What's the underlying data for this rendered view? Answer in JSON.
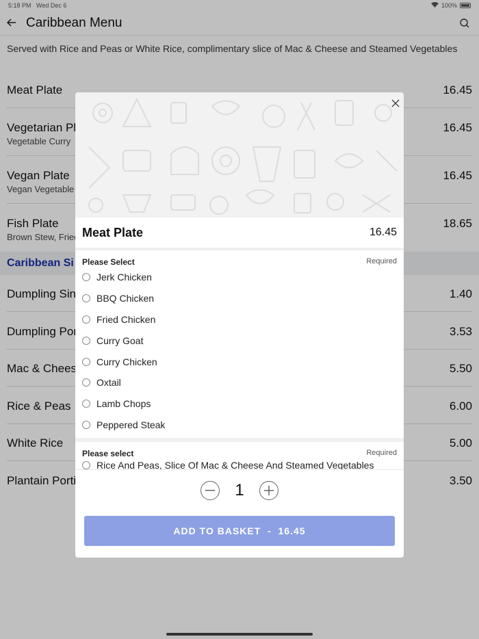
{
  "status": {
    "time": "5:18 PM",
    "date": "Wed Dec 6",
    "battery": "100%"
  },
  "nav": {
    "title": "Caribbean Menu",
    "back_icon": "arrow-left-icon",
    "search_icon": "search-icon"
  },
  "description": "Served with Rice and Peas or White Rice, complimentary slice of Mac & Cheese and Steamed Vegetables",
  "menu": [
    {
      "name": "Meat Plate",
      "sub": "",
      "price": "16.45"
    },
    {
      "name": "Vegetarian Pl",
      "sub": "Vegetable Curry",
      "price": "16.45"
    },
    {
      "name": "Vegan Plate",
      "sub": "Vegan Vegetable C",
      "price": "16.45"
    },
    {
      "name": "Fish Plate",
      "sub": "Brown Stew, Fried",
      "price": "18.65"
    }
  ],
  "section": {
    "title": "Caribbean Si"
  },
  "sides": [
    {
      "name": "Dumpling Sing",
      "price": "1.40"
    },
    {
      "name": "Dumpling Por",
      "price": "3.53"
    },
    {
      "name": "Mac & Cheese",
      "price": "5.50"
    },
    {
      "name": "Rice & Peas",
      "price": "6.00"
    },
    {
      "name": "White Rice",
      "price": "5.00"
    },
    {
      "name": "Plantain Porti",
      "price": "3.50"
    }
  ],
  "modal": {
    "item_name": "Meat Plate",
    "item_price": "16.45",
    "close_icon": "close-icon",
    "group1": {
      "label": "Please Select",
      "required": "Required",
      "options": [
        "Jerk Chicken",
        "BBQ Chicken",
        "Fried Chicken",
        "Curry Goat",
        "Curry Chicken",
        "Oxtail",
        "Lamb Chops",
        "Peppered Steak"
      ]
    },
    "group2": {
      "label": "Please select",
      "required": "Required",
      "options": [
        "Rice And Peas, Slice Of Mac & Cheese And Steamed Vegetables"
      ]
    },
    "quantity": "1",
    "add_label": "ADD TO BASKET",
    "add_sep": "-",
    "add_price": "16.45"
  }
}
